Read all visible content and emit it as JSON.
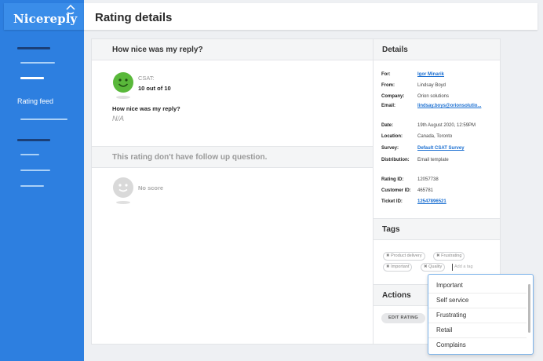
{
  "app": {
    "logo": "Nicereply"
  },
  "sidebar": {
    "active_label": "Rating feed"
  },
  "header": {
    "title": "Rating details"
  },
  "main": {
    "question_header": "How nice was my reply?",
    "csat_label": "CSAT:",
    "csat_value": "10 out of 10",
    "question": "How nice was my reply?",
    "answer": "N/A",
    "followup_header": "This rating don't have follow up question.",
    "no_score": "No score"
  },
  "details": {
    "title": "Details",
    "for_label": "For:",
    "for_value": "Igor Minarik",
    "from_label": "From:",
    "from_value": "Lindsay Boyd",
    "company_label": "Company:",
    "company_value": "Orion solutions",
    "email_label": "Email:",
    "email_value": "lindsay.boys@orionsolutio...",
    "date_label": "Date:",
    "date_value": "19th August 2020, 12:59PM",
    "location_label": "Location:",
    "location_value": "Canada, Toronto",
    "survey_label": "Survey:",
    "survey_value": "Default CSAT Survey",
    "distribution_label": "Distribution:",
    "distribution_value": "Email template",
    "rating_id_label": "Rating ID:",
    "rating_id_value": "12057738",
    "customer_id_label": "Customer ID:",
    "customer_id_value": "465781",
    "ticket_id_label": "Ticket ID:",
    "ticket_id_value": "12547896521"
  },
  "tags": {
    "title": "Tags",
    "items": [
      "Product delivery",
      "Frustrating",
      "Important",
      "Quality"
    ],
    "remove_glyph": "✖",
    "placeholder": "Add a tag"
  },
  "actions": {
    "title": "Actions",
    "edit_label": "EDIT RATING"
  },
  "dropdown": {
    "options": [
      "Important",
      "Self service",
      "Frustrating",
      "Retail",
      "Complains"
    ]
  },
  "colors": {
    "sidebar": "#2d7fe0",
    "accent": "#1b6fd1",
    "csat_green": "#59b83a"
  }
}
